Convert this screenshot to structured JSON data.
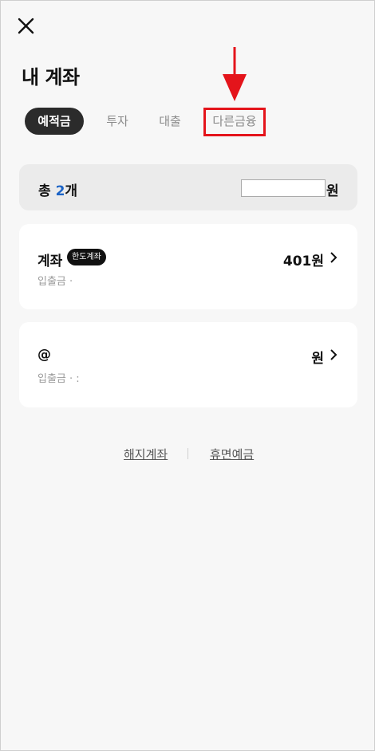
{
  "header": {
    "title": "내 계좌"
  },
  "tabs": [
    {
      "label": "예적금",
      "active": true
    },
    {
      "label": "투자",
      "active": false
    },
    {
      "label": "대출",
      "active": false
    },
    {
      "label": "다른금융",
      "active": false
    }
  ],
  "summary": {
    "prefix": "총 ",
    "count": "2",
    "suffix": "개",
    "currency": "원"
  },
  "accounts": [
    {
      "name": "계좌",
      "badge": "한도계좌",
      "amount": "401원",
      "sub": "입출금 ·"
    },
    {
      "name": "@",
      "amount": "원",
      "sub": "입출금 · :"
    }
  ],
  "footer": {
    "closed_accounts": "해지계좌",
    "dormant_deposits": "휴면예금"
  },
  "colors": {
    "accent_blue": "#1b63c6",
    "highlight_red": "#e4141b",
    "active_tab_bg": "#2b2b2b"
  }
}
